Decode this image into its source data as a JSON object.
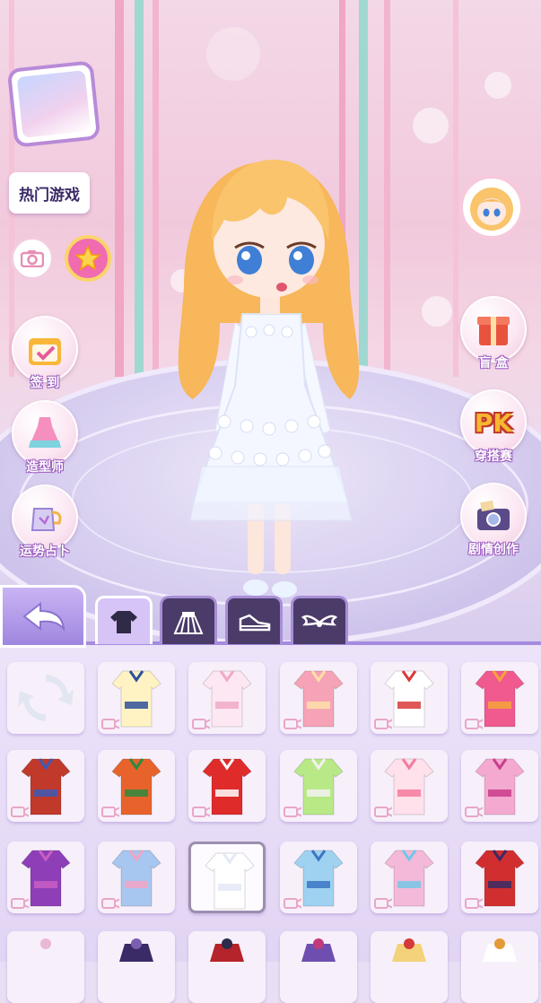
{
  "buttons": {
    "hot_games": "热门游戏",
    "checkin": "签 到",
    "stylist": "造型师",
    "fortune": "运势占卜",
    "blind_box": "盲 盒",
    "pk": "穿搭赛",
    "pk_badge": "PK",
    "story": "剧情创作"
  },
  "tabs": [
    {
      "icon": "shirt-icon",
      "active": true
    },
    {
      "icon": "skirt-icon",
      "active": false
    },
    {
      "icon": "shoe-icon",
      "active": false
    },
    {
      "icon": "wings-icon",
      "active": false
    }
  ],
  "items": [
    {
      "kind": "refresh-icon",
      "color": "#ffffff",
      "accent": "#ffffff",
      "video": false
    },
    {
      "kind": "corset-top",
      "color": "#fff3c4",
      "accent": "#2f4f9a",
      "video": true
    },
    {
      "kind": "cupcake-top",
      "color": "#fde7f2",
      "accent": "#f0a9c8",
      "video": true
    },
    {
      "kind": "heart-top",
      "color": "#f7a3b7",
      "accent": "#fde1a8",
      "video": true
    },
    {
      "kind": "sailor-top",
      "color": "#ffffff",
      "accent": "#d93a3a",
      "video": true
    },
    {
      "kind": "cat-top",
      "color": "#f05a8f",
      "accent": "#f6a43a",
      "video": true
    },
    {
      "kind": "circus-top",
      "color": "#c0392b",
      "accent": "#3b5bb5",
      "video": true
    },
    {
      "kind": "pumpkin-top",
      "color": "#e8632b",
      "accent": "#2b8a3e",
      "video": true
    },
    {
      "kind": "red-top",
      "color": "#e02b2b",
      "accent": "#ffffff",
      "video": true
    },
    {
      "kind": "green-top",
      "color": "#b8e986",
      "accent": "#f2f2f2",
      "video": true
    },
    {
      "kind": "kimono-top",
      "color": "#ffe1ec",
      "accent": "#f47a9c",
      "video": true
    },
    {
      "kind": "sport-top",
      "color": "#f4a9d0",
      "accent": "#c93d8c",
      "video": true
    },
    {
      "kind": "purple-corset",
      "color": "#8e3fb8",
      "accent": "#c95ec3",
      "video": true
    },
    {
      "kind": "plaid-top",
      "color": "#a7c6f0",
      "accent": "#f4a3c4",
      "video": true
    },
    {
      "kind": "white-crop",
      "color": "#ffffff",
      "accent": "#e4e9f7",
      "video": false,
      "selected": true
    },
    {
      "kind": "blue-bow-top",
      "color": "#9fd2f0",
      "accent": "#3a76c4",
      "video": true
    },
    {
      "kind": "pink-blue-top",
      "color": "#f4b8d8",
      "accent": "#74c7e8",
      "video": true
    },
    {
      "kind": "red-corset",
      "color": "#d12f2f",
      "accent": "#3a2a66",
      "video": true
    },
    {
      "kind": "partial",
      "color": "#f7f0fb",
      "accent": "#e9b8d6",
      "video": false
    },
    {
      "kind": "partial",
      "color": "#3a2a66",
      "accent": "#7a5fb0",
      "video": false
    },
    {
      "kind": "partial",
      "color": "#b5232b",
      "accent": "#2b2b4a",
      "video": false
    },
    {
      "kind": "partial",
      "color": "#6e4fb0",
      "accent": "#c23b7a",
      "video": false
    },
    {
      "kind": "partial",
      "color": "#f3d27a",
      "accent": "#d33a3a",
      "video": false
    },
    {
      "kind": "partial",
      "color": "#ffffff",
      "accent": "#e59a3a",
      "video": false
    }
  ],
  "colors": {
    "accent": "#a48bdf",
    "label_outline": "#9a5bbf",
    "hair": "#f7b75a",
    "dress": "#f4f7ff"
  }
}
